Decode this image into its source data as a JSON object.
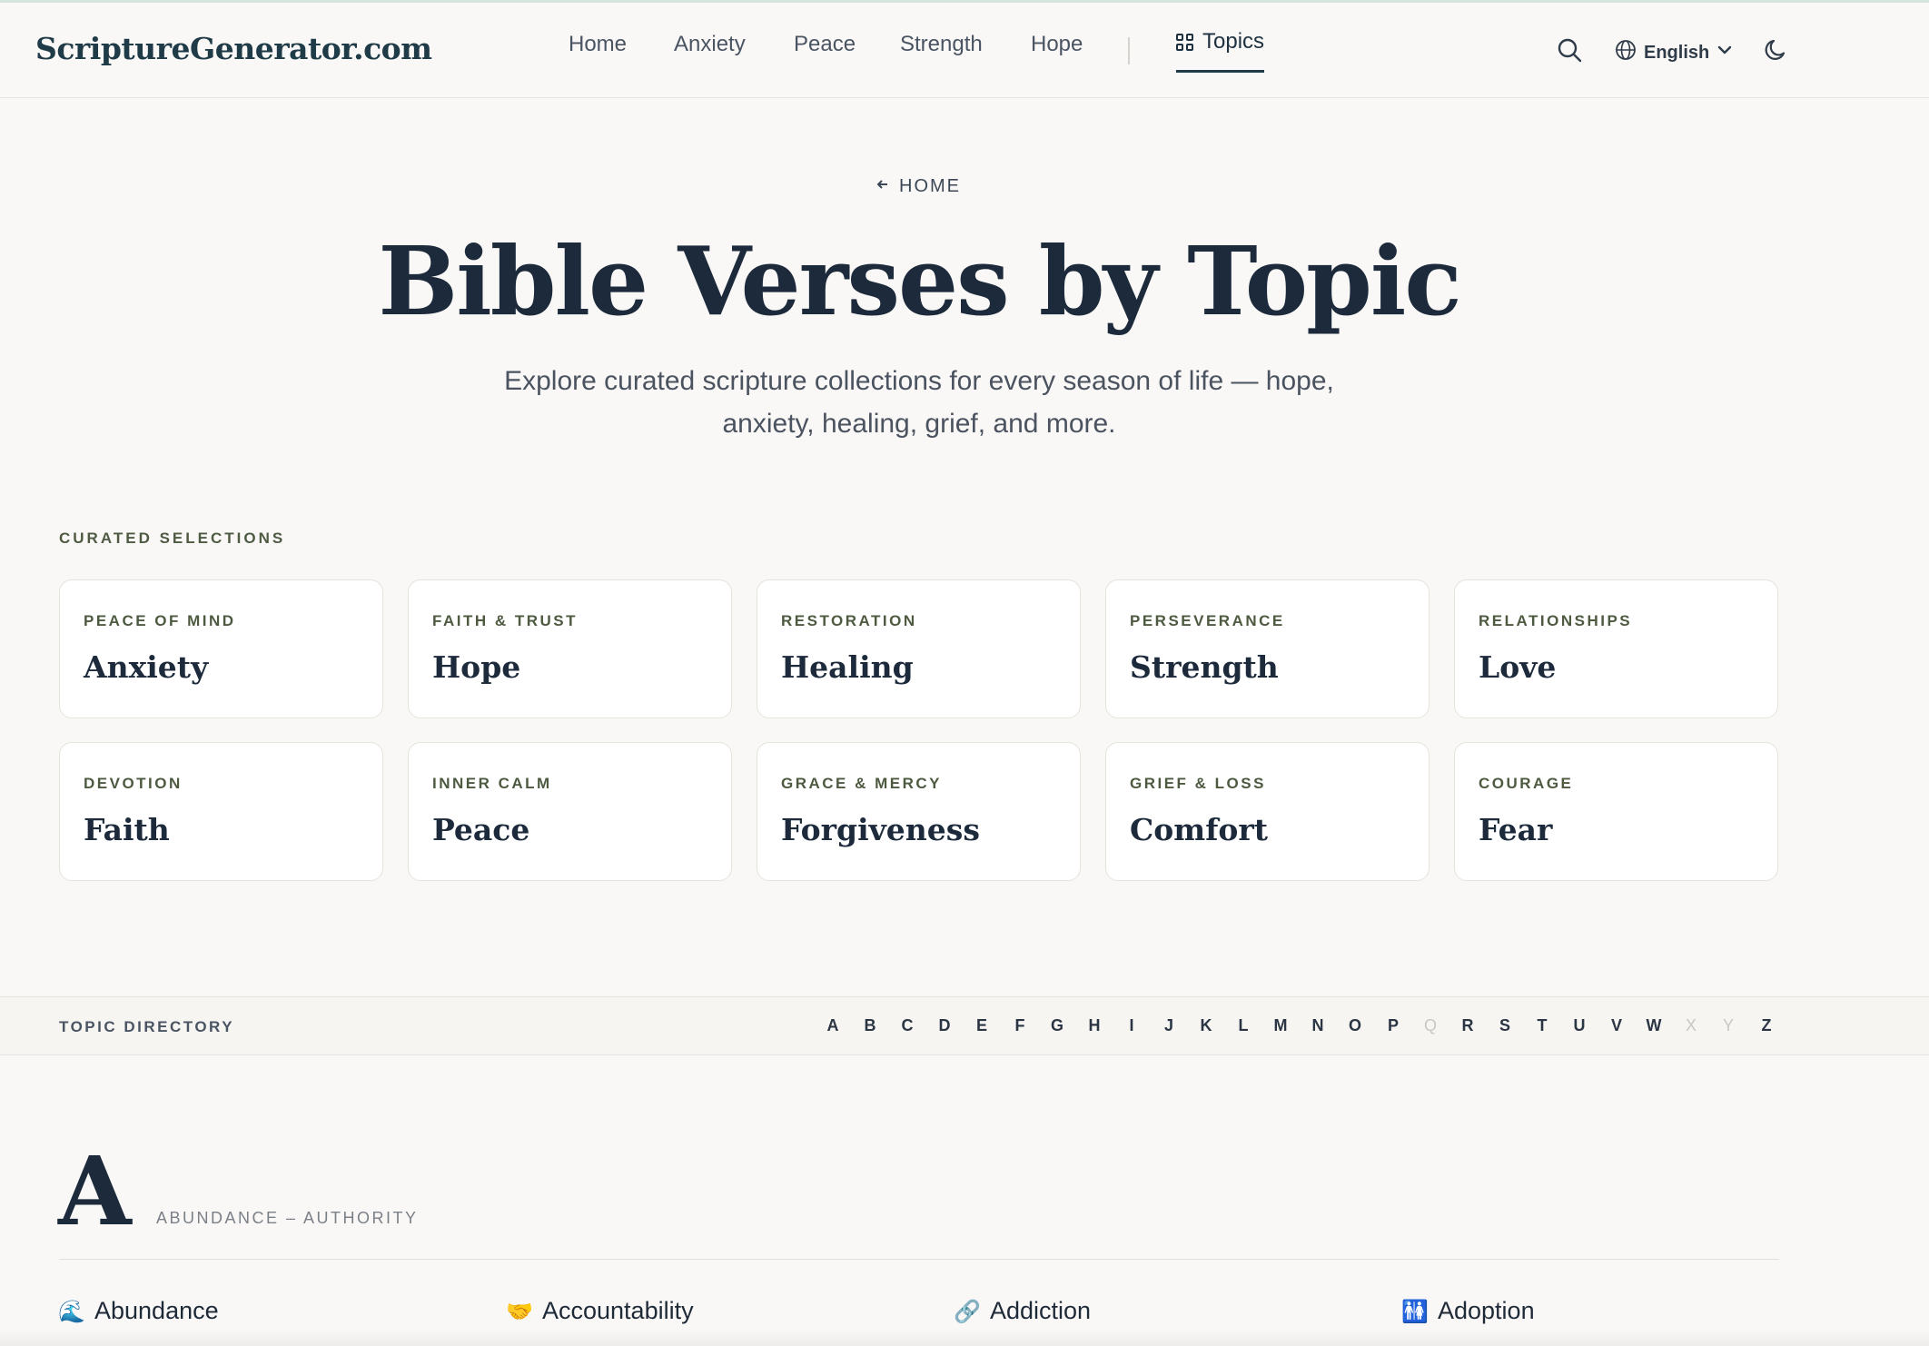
{
  "header": {
    "logo": "ScriptureGenerator.com",
    "nav": [
      "Home",
      "Anxiety",
      "Peace",
      "Strength",
      "Hope"
    ],
    "active_tab": "Topics",
    "language": "English",
    "icons": [
      "search-icon",
      "globe-icon",
      "chevron-down-icon",
      "moon-icon",
      "grid-icon"
    ]
  },
  "hero": {
    "back_label": "HOME",
    "title": "Bible Verses by Topic",
    "subtitle_line1": "Explore curated scripture collections for every season of life — hope,",
    "subtitle_line2": "anxiety, healing, grief, and more."
  },
  "curated": {
    "label": "CURATED SELECTIONS",
    "cards": [
      {
        "kicker": "PEACE OF MIND",
        "title": "Anxiety"
      },
      {
        "kicker": "FAITH & TRUST",
        "title": "Hope"
      },
      {
        "kicker": "RESTORATION",
        "title": "Healing"
      },
      {
        "kicker": "PERSEVERANCE",
        "title": "Strength"
      },
      {
        "kicker": "RELATIONSHIPS",
        "title": "Love"
      },
      {
        "kicker": "DEVOTION",
        "title": "Faith"
      },
      {
        "kicker": "INNER CALM",
        "title": "Peace"
      },
      {
        "kicker": "GRACE & MERCY",
        "title": "Forgiveness"
      },
      {
        "kicker": "GRIEF & LOSS",
        "title": "Comfort"
      },
      {
        "kicker": "COURAGE",
        "title": "Fear"
      }
    ]
  },
  "directory": {
    "label": "TOPIC DIRECTORY",
    "letters": [
      "A",
      "B",
      "C",
      "D",
      "E",
      "F",
      "G",
      "H",
      "I",
      "J",
      "K",
      "L",
      "M",
      "N",
      "O",
      "P",
      "Q",
      "R",
      "S",
      "T",
      "U",
      "V",
      "W",
      "X",
      "Y",
      "Z"
    ],
    "disabled_letters": [
      "Q",
      "X",
      "Y"
    ]
  },
  "section_a": {
    "letter": "A",
    "range": "ABUNDANCE – AUTHORITY",
    "topics": [
      {
        "emoji": "🌊",
        "label": "Abundance"
      },
      {
        "emoji": "🤝",
        "label": "Accountability"
      },
      {
        "emoji": "🔗",
        "label": "Addiction"
      },
      {
        "emoji": "🚻",
        "label": "Adoption"
      }
    ]
  },
  "colors": {
    "background": "#f9f8f6",
    "heading": "#1c2a3b",
    "logo": "#1f3b48",
    "kicker": "#4d5a40",
    "card": "#ffffff"
  }
}
